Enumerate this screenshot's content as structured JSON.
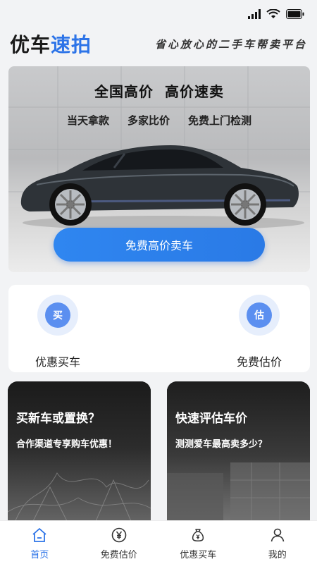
{
  "header": {
    "logo_main": "优车",
    "logo_accent": "速拍",
    "slogan": "省心放心的二手车帮卖平台"
  },
  "hero": {
    "title": "全国高价 高价速卖",
    "features": [
      "当天拿款",
      "多家比价",
      "免费上门检测"
    ],
    "cta_label": "免费高价卖车"
  },
  "quick_actions": [
    {
      "icon_glyph": "买",
      "label": "优惠买车",
      "icon": "buy-icon"
    },
    {
      "icon_glyph": "估",
      "label": "免费估价",
      "icon": "estimate-icon"
    }
  ],
  "promos": [
    {
      "title": "买新车或置换？",
      "subtitle": "合作渠道专享购车优惠！"
    },
    {
      "title": "快速评估车价",
      "subtitle": "测测爱车最高卖多少？"
    }
  ],
  "nav": {
    "items": [
      {
        "label": "首页",
        "icon": "home-icon",
        "active": true
      },
      {
        "label": "免费估价",
        "icon": "yen-coin-icon",
        "active": false
      },
      {
        "label": "优惠买车",
        "icon": "money-bag-icon",
        "active": false
      },
      {
        "label": "我的",
        "icon": "user-icon",
        "active": false
      }
    ]
  },
  "colors": {
    "accent": "#2d74e8",
    "background": "#f2f3f5"
  }
}
